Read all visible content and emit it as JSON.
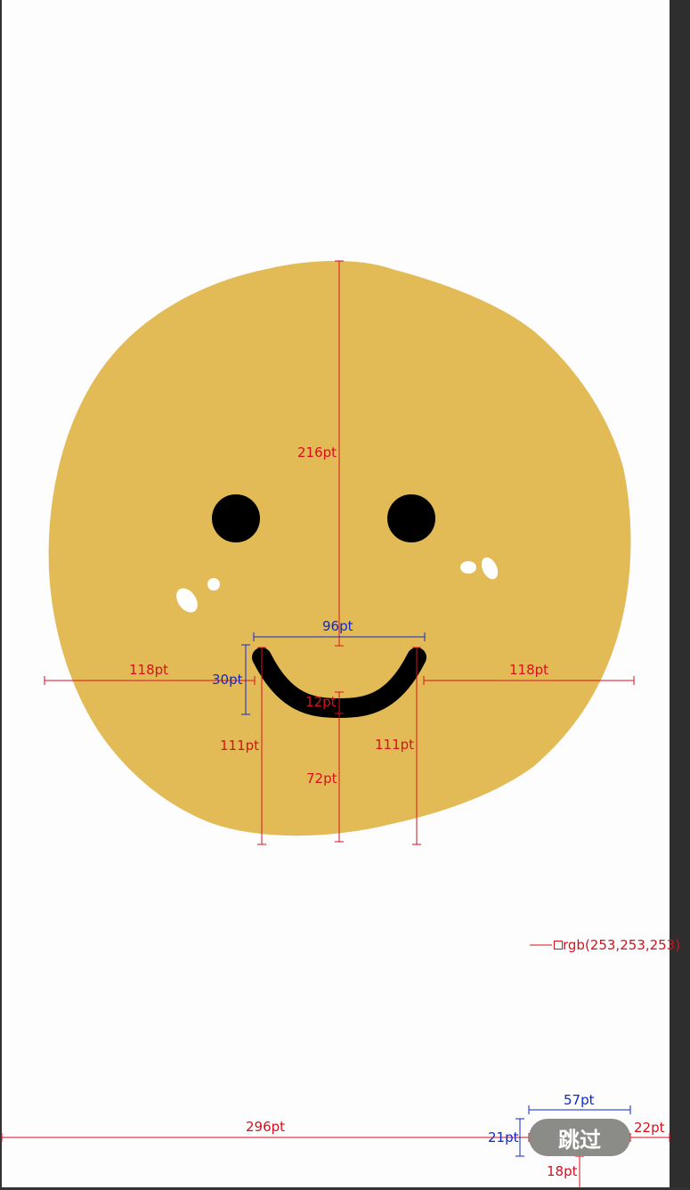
{
  "colors": {
    "background": "#fdfdfd",
    "face": "#e2bb57",
    "feature": "#000000",
    "skip_button_bg": "#8b8b88",
    "spec_red": "#d8101c",
    "spec_blue": "#1028d0"
  },
  "skip_button": {
    "label": "跳过"
  },
  "annotations": {
    "face_height": "216pt",
    "mouth_width": "96pt",
    "left_margin": "118pt",
    "right_margin": "118pt",
    "mouth_height": "30pt",
    "mouth_thickness": "12pt",
    "left_corner_to_bottom": "111pt",
    "right_corner_to_bottom": "111pt",
    "mouth_to_bottom": "72pt",
    "background_color": "rgb(253,253,253)",
    "button_width": "57pt",
    "button_left_offset": "296pt",
    "button_height": "21pt",
    "button_right_margin": "22pt",
    "button_bottom_margin": "18pt"
  }
}
